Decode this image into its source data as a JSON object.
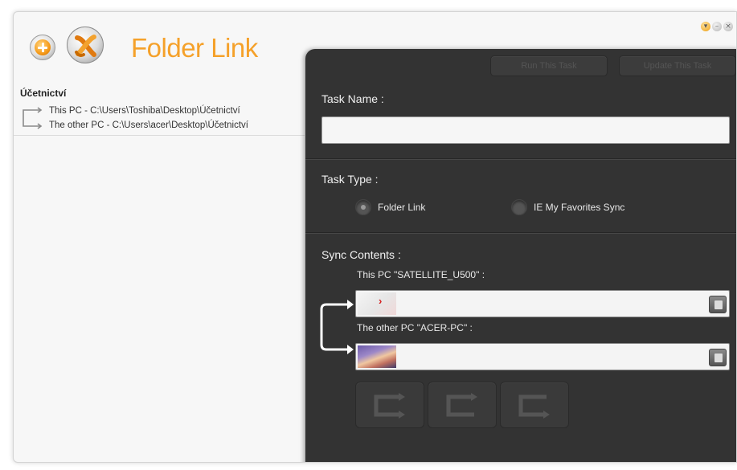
{
  "app": {
    "title": "Folder Link"
  },
  "toolbar": {
    "add_icon": "plus-icon",
    "logo_icon": "folder-link-logo-icon"
  },
  "window_controls": [
    "down-icon",
    "minimize-icon",
    "close-icon"
  ],
  "task_list": {
    "items": [
      {
        "name": "Účetnictví",
        "this_pc_path": "This PC - C:\\Users\\Toshiba\\Desktop\\Účetnictví",
        "other_pc_path": "The other PC - C:\\Users\\acer\\Desktop\\Účetnictví"
      }
    ]
  },
  "panel": {
    "buttons": {
      "run": "Run This Task",
      "update": "Update This Task"
    },
    "task_name": {
      "label": "Task Name :",
      "value": ""
    },
    "task_type": {
      "label": "Task Type :",
      "options": [
        "Folder Link",
        "IE My Favorites Sync"
      ],
      "selected": "Folder Link"
    },
    "sync_contents": {
      "label": "Sync Contents :",
      "this_pc": {
        "label": "This PC \"SATELLITE_U500\" :",
        "path": ""
      },
      "other_pc": {
        "label": "The other PC \"ACER-PC\" :",
        "path": ""
      }
    },
    "direction_buttons": [
      "sync-both-ways-icon",
      "sync-left-icon",
      "sync-right-icon"
    ]
  },
  "colors": {
    "accent": "#f5a12a",
    "panel": "#333333",
    "background": "#f7f7f7"
  }
}
